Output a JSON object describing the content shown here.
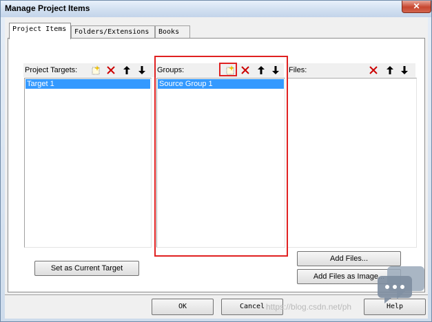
{
  "window": {
    "title": "Manage Project Items",
    "close_label": "✕"
  },
  "tabs": [
    {
      "label": "Project Items",
      "active": true
    },
    {
      "label": "Folders/Extensions",
      "active": false
    },
    {
      "label": "Books",
      "active": false
    }
  ],
  "targets": {
    "label": "Project Targets:",
    "items": [
      "Target 1"
    ],
    "selected": "Target 1"
  },
  "groups": {
    "label": "Groups:",
    "items": [
      "Source Group 1"
    ],
    "selected": "Source Group 1"
  },
  "files": {
    "label": "Files:",
    "items": []
  },
  "buttons": {
    "set_current_target": "Set as Current Target",
    "add_files": "Add Files...",
    "add_files_as_image": "Add Files as Image...",
    "ok": "OK",
    "cancel": "Cancel",
    "help": "Help"
  },
  "watermark": "https://blog.csdn.net/ph",
  "colors": {
    "selection": "#3399ff",
    "highlight_box": "#e02020",
    "delete_icon": "#cc0000"
  }
}
